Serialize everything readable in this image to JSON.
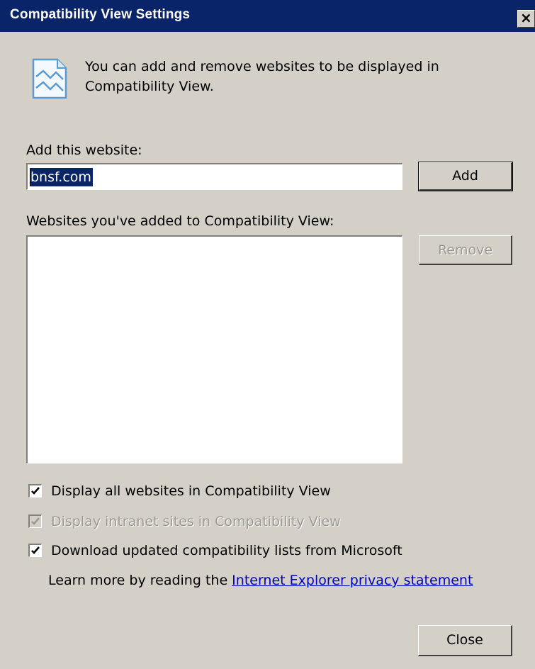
{
  "window": {
    "title": "Compatibility View Settings",
    "close_glyph": "×"
  },
  "info": {
    "icon": "compatibility-view-icon",
    "text": "You can add and remove websites to be displayed in Compatibility View."
  },
  "add_site": {
    "label": "Add this website:",
    "value": "bnsf.com",
    "add_button": "Add"
  },
  "sites_list": {
    "label": "Websites you've added to Compatibility View:",
    "items": [],
    "remove_button": "Remove"
  },
  "options": [
    {
      "label": "Display all websites in Compatibility View",
      "checked": true,
      "enabled": true
    },
    {
      "label": "Display intranet sites in Compatibility View",
      "checked": true,
      "enabled": false
    },
    {
      "label": "Download updated compatibility lists from Microsoft",
      "checked": true,
      "enabled": true
    }
  ],
  "learn_more": {
    "prefix": "Learn more by reading the ",
    "link": "Internet Explorer privacy statement"
  },
  "footer": {
    "close_button": "Close"
  },
  "colors": {
    "titlebar": "#0a246a",
    "dialog_bg": "#d4d0c8",
    "selection": "#0a246a",
    "link": "#0000cc",
    "disabled_text": "#9d9a93"
  }
}
